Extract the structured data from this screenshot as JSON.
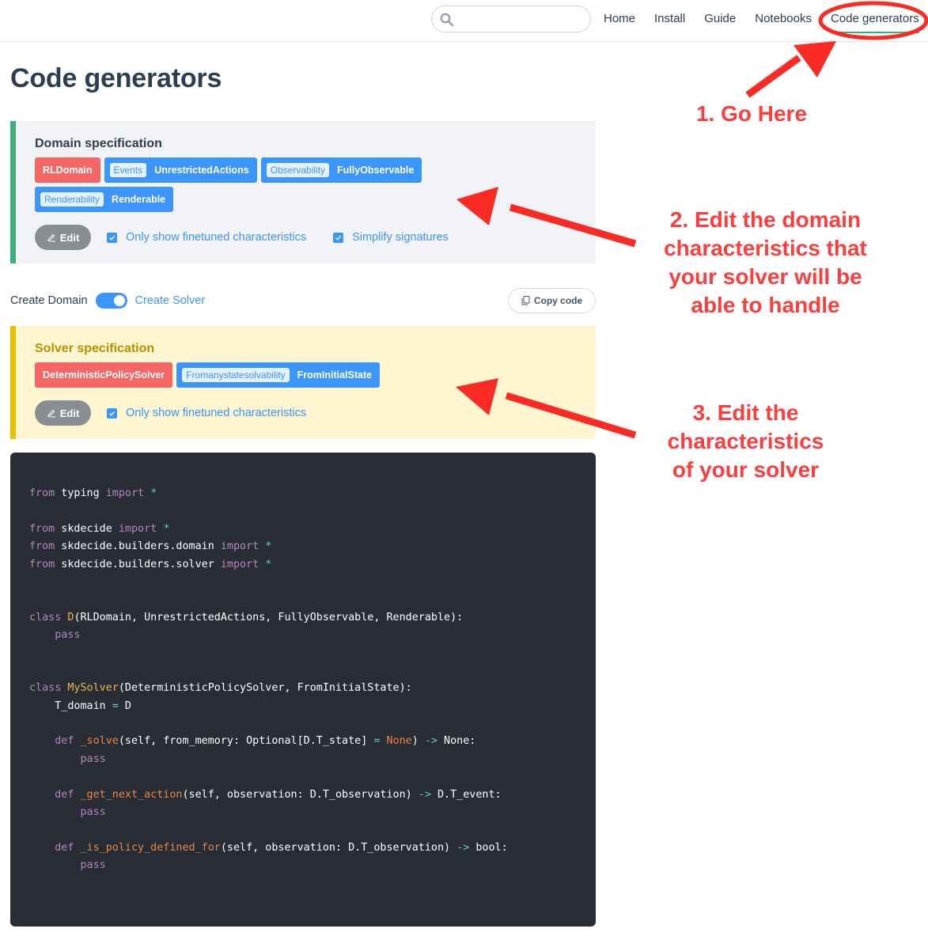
{
  "navbar": {
    "search_placeholder": "",
    "links": [
      {
        "label": "Home"
      },
      {
        "label": "Install"
      },
      {
        "label": "Guide"
      },
      {
        "label": "Notebooks"
      },
      {
        "label": "Code generators",
        "active": true
      }
    ],
    "accent_color": "#3eaf7c"
  },
  "page": {
    "title": "Code generators"
  },
  "domain_spec": {
    "title": "Domain specification",
    "tags": [
      {
        "type": "base",
        "value": "RLDomain"
      },
      {
        "type": "characteristic",
        "category": "Events",
        "value": "UnrestrictedActions"
      },
      {
        "type": "characteristic",
        "category": "Observability",
        "value": "FullyObservable"
      },
      {
        "type": "characteristic",
        "category": "Renderability",
        "value": "Renderable"
      }
    ],
    "edit_label": "Edit",
    "checkboxes": [
      {
        "label": "Only show finetuned characteristics",
        "checked": true
      },
      {
        "label": "Simplify signatures",
        "checked": true
      }
    ]
  },
  "mode_toggle": {
    "left_label": "Create Domain",
    "right_label": "Create Solver",
    "state": "Create Solver"
  },
  "copy_button": {
    "label": "Copy code"
  },
  "solver_spec": {
    "title": "Solver specification",
    "tags": [
      {
        "type": "base",
        "value": "DeterministicPolicySolver"
      },
      {
        "type": "characteristic",
        "category": "Fromanystatesolvability",
        "value": "FromInitialState"
      }
    ],
    "edit_label": "Edit",
    "checkboxes": [
      {
        "label": "Only show finetuned characteristics",
        "checked": true
      }
    ]
  },
  "code": {
    "language": "python",
    "lines": [
      "from typing import *",
      "",
      "from skdecide import *",
      "from skdecide.builders.domain import *",
      "from skdecide.builders.solver import *",
      "",
      "",
      "class D(RLDomain, UnrestrictedActions, FullyObservable, Renderable):",
      "    pass",
      "",
      "",
      "class MySolver(DeterministicPolicySolver, FromInitialState):",
      "    T_domain = D",
      "",
      "    def _solve(self, from_memory: Optional[D.T_state] = None) -> None:",
      "        pass",
      "",
      "    def _get_next_action(self, observation: D.T_observation) -> D.T_event:",
      "        pass",
      "",
      "    def _is_policy_defined_for(self, observation: D.T_observation) -> bool:",
      "        pass"
    ]
  },
  "annotations": {
    "color": "#fb3e3e",
    "step1": "1. Go Here",
    "step2": [
      "2. Edit the domain",
      "characteristics that",
      "your solver will be",
      "able to handle"
    ],
    "step3": [
      "3. Edit the",
      "characteristics",
      "of your solver"
    ]
  }
}
